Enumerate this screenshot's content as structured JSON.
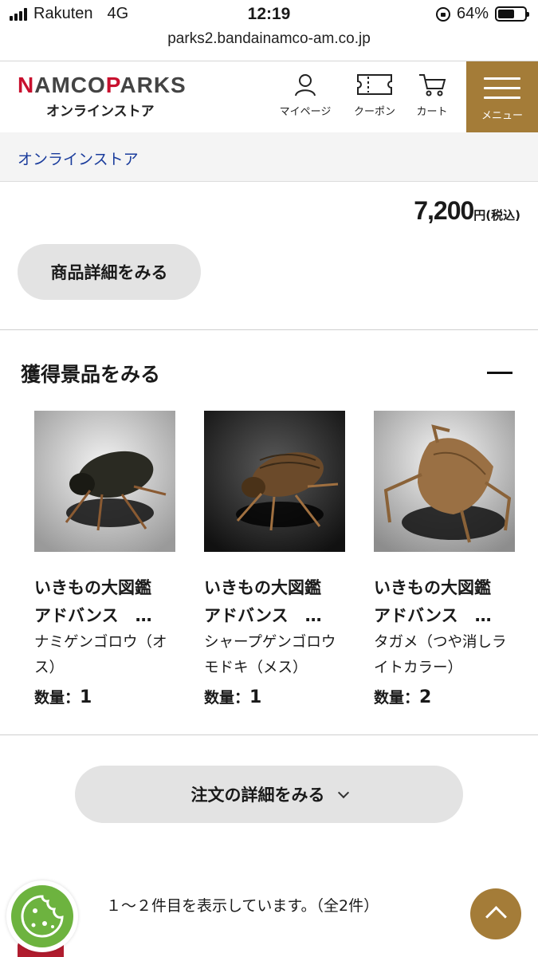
{
  "status_bar": {
    "carrier": "Rakuten",
    "network": "4G",
    "time": "12:19",
    "battery": "64%",
    "battery_level": 0.64
  },
  "browser": {
    "url": "parks2.bandainamco-am.co.jp"
  },
  "header": {
    "logo_main_red": "N",
    "logo_main_1": "AMCO",
    "logo_main_red2": "P",
    "logo_main_2": "ARKS",
    "logo_sub": "オンラインストア",
    "nav": {
      "mypage": "マイページ",
      "coupon": "クーポン",
      "cart": "カート",
      "menu": "メニュー"
    },
    "accent_color": "#a47c38"
  },
  "breadcrumb": {
    "label": "オンラインストア"
  },
  "price": {
    "value": "7,200",
    "unit": "円(税込)"
  },
  "buttons": {
    "product_detail": "商品詳細をみる",
    "order_detail": "注文の詳細をみる"
  },
  "prizes": {
    "title": "獲得景品をみる",
    "qty_label": "数量：",
    "items": [
      {
        "name1": "いきもの大図鑑",
        "name2": "アドバンス　…",
        "name3": "ナミゲンゴロウ（オス）",
        "qty": "1",
        "bg": "light",
        "icon": "diving-beetle-photo"
      },
      {
        "name1": "いきもの大図鑑",
        "name2": "アドバンス　…",
        "name3": "シャープゲンゴロウモドキ（メス）",
        "qty": "1",
        "bg": "dark",
        "icon": "diving-beetle-photo"
      },
      {
        "name1": "いきもの大図鑑",
        "name2": "アドバンス　…",
        "name3": "タガメ（つや消しライトカラー）",
        "qty": "2",
        "bg": "light",
        "icon": "giant-water-bug-photo"
      }
    ]
  },
  "pagination": {
    "text": "１～２件目を表示しています。（全2件）"
  }
}
